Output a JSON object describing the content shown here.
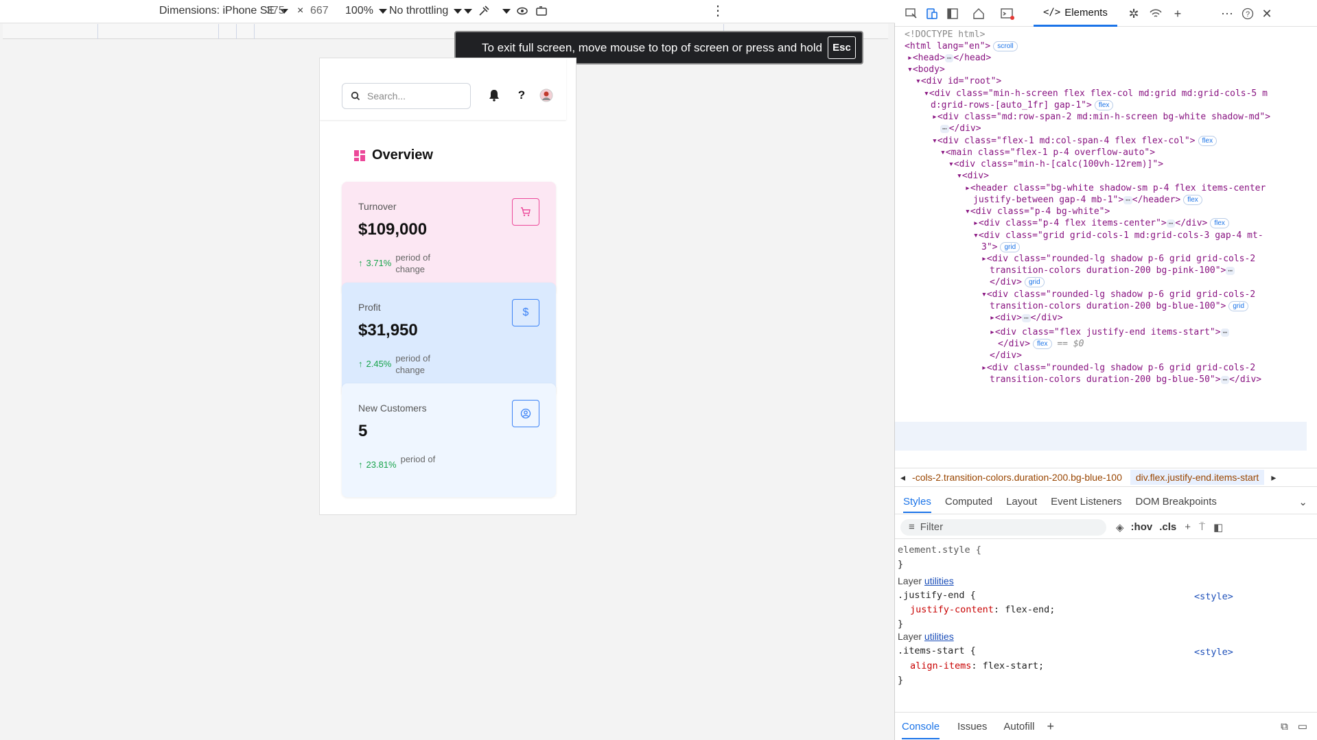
{
  "emulation": {
    "device": "Dimensions: iPhone SE",
    "width": "375",
    "times": "×",
    "height": "667",
    "zoom": "100%",
    "throttling": "No throttling"
  },
  "fullscreen_banner": {
    "text": "To exit full screen, move mouse to top of screen or press and hold",
    "key": "Esc"
  },
  "app": {
    "search_placeholder": "Search...",
    "overview_title": "Overview",
    "cards": [
      {
        "label": "Turnover",
        "value": "$109,000",
        "pct": "3.71%",
        "note": "period of change",
        "bg": "#fce7f3",
        "accent": "#ec4899"
      },
      {
        "label": "Profit",
        "value": "$31,950",
        "pct": "2.45%",
        "note": "period of change",
        "bg": "#dbeafe",
        "accent": "#3b82f6"
      },
      {
        "label": "New Customers",
        "value": "5",
        "pct": "23.81%",
        "note": "period of",
        "bg": "#eff6ff",
        "accent": "#3b82f6"
      }
    ]
  },
  "devtools": {
    "elements_tab": "Elements",
    "dom_lines": [
      "<!DOCTYPE html>",
      "<html lang=\"en\">",
      "<head>",
      "</head>",
      "<body>",
      "<div id=\"root\">",
      "<div class=\"min-h-screen flex flex-col md:grid md:grid-cols-5 m",
      "d:grid-rows-[auto_1fr] gap-1\">",
      "<div class=\"md:row-span-2 md:min-h-screen bg-white shadow-md\">",
      "</div>",
      "<div class=\"flex-1 md:col-span-4 flex flex-col\">",
      "<main class=\"flex-1 p-4 overflow-auto\">",
      "<div class=\"min-h-[calc(100vh-12rem)]\">",
      "<div>",
      "<header class=\"bg-white shadow-sm p-4 flex items-center",
      "justify-between gap-4 mb-1\">",
      "</header>",
      "<div class=\"p-4 bg-white\">",
      "<div class=\"p-4 flex items-center\">",
      "</div>",
      "<div class=\"grid grid-cols-1 md:grid-cols-3 gap-4 mt-",
      "3\">",
      "<div class=\"rounded-lg shadow p-6 grid grid-cols-2",
      "transition-colors duration-200 bg-pink-100\">",
      "</div>",
      "<div class=\"rounded-lg shadow p-6 grid grid-cols-2",
      "transition-colors duration-200 bg-blue-100\">",
      "<div>",
      "</div>",
      "<div class=\"flex justify-end items-start\">",
      "</div>",
      "== $0",
      "</div>",
      "<div class=\"rounded-lg shadow p-6 grid grid-cols-2",
      "transition-colors duration-200 bg-blue-50\">",
      "</div>"
    ],
    "badges": {
      "scroll": "scroll",
      "flex": "flex",
      "grid": "grid"
    },
    "breadcrumb_left": "-cols-2.transition-colors.duration-200.bg-blue-100",
    "breadcrumb_right": "div.flex.justify-end.items-start",
    "sub_tabs": [
      "Styles",
      "Computed",
      "Layout",
      "Event Listeners",
      "DOM Breakpoints"
    ],
    "filter_placeholder": "Filter",
    "hov": ":hov",
    "cls": ".cls",
    "styles": {
      "element_style": "element.style {",
      "close": "}",
      "layer_label": "Layer",
      "layer_link": "utilities",
      "rule1_selector": ".justify-end {",
      "rule1_prop": "justify-content",
      "rule1_val": "flex-end;",
      "rule2_selector": ".items-start {",
      "rule2_prop": "align-items",
      "rule2_val": "flex-start;",
      "source": "<style>"
    },
    "console_tabs": [
      "Console",
      "Issues",
      "Autofill"
    ]
  },
  "colors": {
    "accent_blue": "#1a73e8",
    "green_up": "#16a34a"
  }
}
